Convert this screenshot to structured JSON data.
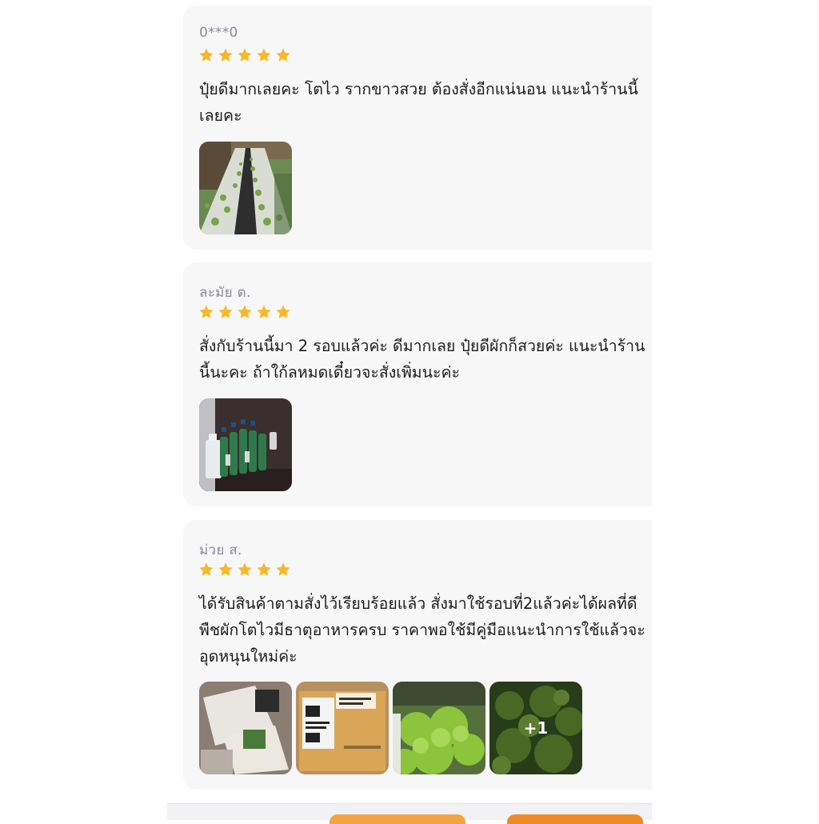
{
  "colors": {
    "card_bg": "#f7f7f8",
    "star": "#f7b928",
    "name_text": "#8a8a94",
    "body_text": "#1c1c1e",
    "accent_button": "#f4a340"
  },
  "reviews": [
    {
      "name": "0***0",
      "rating": 5,
      "text": "ปุ๋ยดีมากเลยคะ โตไว รากขาวสวย ต้องสั่งอีกแน่นอน แนะนำร้านนี้เลยคะ",
      "photos": [
        {
          "icon": "hydroponic-farm-photo"
        }
      ]
    },
    {
      "name": "ละมัย ต.",
      "rating": 5,
      "text": "สั่งกับร้านนี้มา 2 รอบแล้วค่ะ ดีมากเลย ปุ๋ยดีผักก็สวยค่ะ แนะนำร้านนี้นะคะ ถ้าใก้ลหมดเดี๋ยวจะสั่งเพิ่มนะค่ะ",
      "photos": [
        {
          "icon": "fertilizer-bottles-photo"
        }
      ]
    },
    {
      "name": "ม่วย ส.",
      "rating": 5,
      "text": "ได้รับสินค้าตามสั่งไว้เรียบร้อยแล้ว สั่งมาใช้รอบที่2แล้วค่ะได้ผลที่ดี พืชผักโตไวมีธาตุอาหารครบ ราคาพอใช้มีคู่มือแนะนำการใช้แล้วจะอุดหนุนใหม่ค่ะ",
      "photos": [
        {
          "icon": "product-package-photo"
        },
        {
          "icon": "shipping-box-photo"
        },
        {
          "icon": "lettuce-photo"
        },
        {
          "icon": "green-vegetables-photo"
        }
      ],
      "more_photos_label": "+1"
    }
  ]
}
